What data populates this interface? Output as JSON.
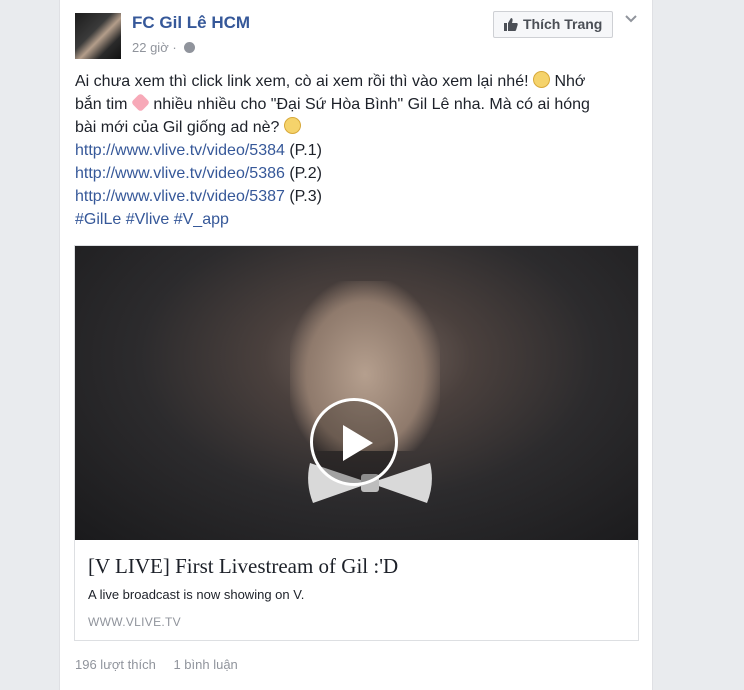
{
  "post": {
    "page_name": "FC Gil Lê HCM",
    "time": "22 giờ",
    "separator": "·",
    "like_page_label": "Thích Trang",
    "text_line1_a": "Ai chưa xem thì click link xem, cò ai xem rồi thì vào xem lại nhé!",
    "text_line1_b": "Nhớ",
    "text_line2_a": "bắn tim",
    "text_line2_b": "nhiều nhiều cho \"Đại Sứ Hòa Bình\" Gil Lê nha. Mà có ai hóng",
    "text_line3": "bài mới của Gil giống ad nè?",
    "links": [
      {
        "url": "http://www.vlive.tv/video/5384",
        "suffix": " (P.1)"
      },
      {
        "url": "http://www.vlive.tv/video/5386",
        "suffix": " (P.2)"
      },
      {
        "url": "http://www.vlive.tv/video/5387",
        "suffix": " (P.3)"
      }
    ],
    "hashtags": [
      "#GilLe",
      "#Vlive",
      "#V_app"
    ]
  },
  "preview": {
    "title": "[V LIVE] First Livestream of Gil :'D",
    "description": "A live broadcast is now showing on V.",
    "domain": "WWW.VLIVE.TV"
  },
  "stats": {
    "likes": "196 lượt thích",
    "comments": "1 bình luận"
  },
  "icons": {
    "emoji_1": "winking-face",
    "emoji_2": "pink-heart",
    "emoji_3": "tongue-out-face",
    "play": "play-icon"
  }
}
